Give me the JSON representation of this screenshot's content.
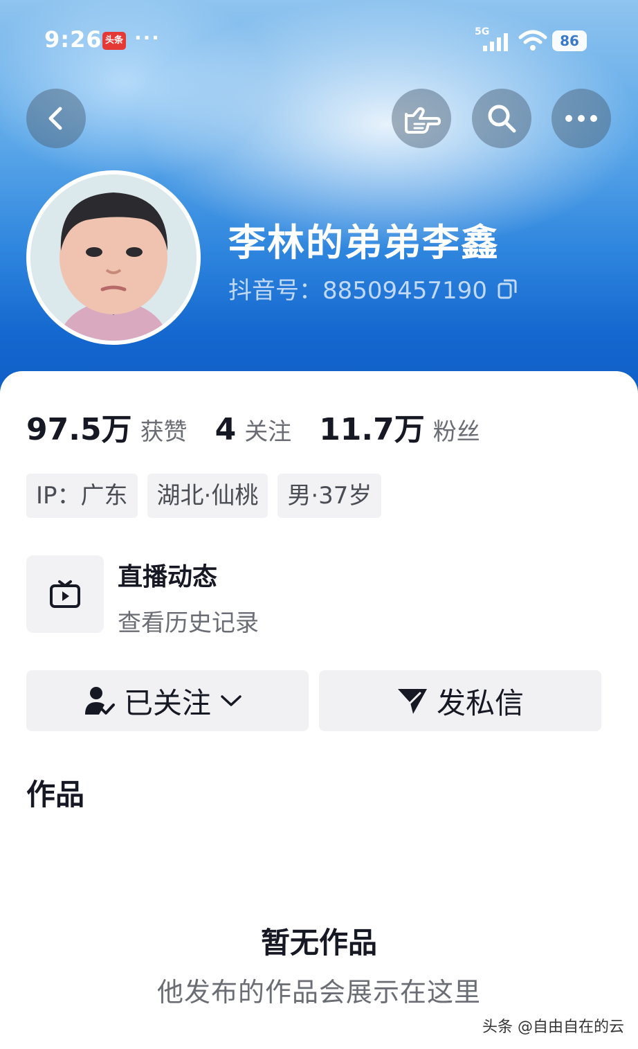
{
  "status_bar": {
    "time": "9:26",
    "app_badge": "头条",
    "dots": "···",
    "network": "5G",
    "battery": "86"
  },
  "top_buttons": {
    "back": "chevron-left-icon",
    "gesture": "pointing-hand-icon",
    "search": "search-icon",
    "more": "more-dots-icon"
  },
  "profile": {
    "nickname": "李林的弟弟李鑫",
    "douyin_id": "抖音号：88509457190"
  },
  "stats": [
    {
      "value": "97.5万",
      "label": "获赞"
    },
    {
      "value": "4",
      "label": "关注"
    },
    {
      "value": "11.7万",
      "label": "粉丝"
    }
  ],
  "tags": [
    "IP：广东",
    "湖北·仙桃",
    "男·37岁"
  ],
  "live": {
    "title": "直播动态",
    "subtitle": "查看历史记录"
  },
  "actions": {
    "follow_label": "已关注",
    "message_label": "发私信"
  },
  "works": {
    "title": "作品",
    "empty_title": "暂无作品",
    "empty_subtitle": "他发布的作品会展示在这里"
  },
  "watermark": "头条 @自由自在的云",
  "colors": {
    "header_top": "#8fc4ef",
    "header_bottom": "#0d5bc4",
    "text_primary": "#161823",
    "text_secondary": "#6b6d75",
    "tag_bg": "#f2f2f4"
  }
}
